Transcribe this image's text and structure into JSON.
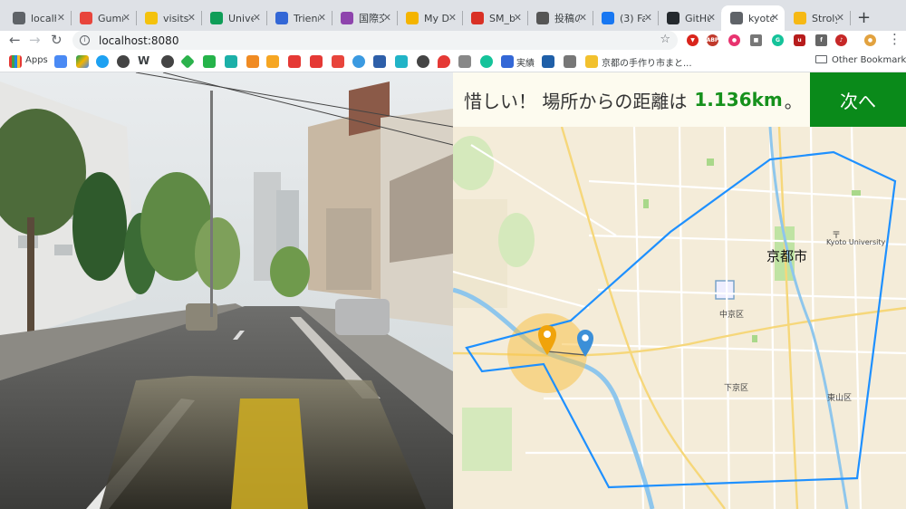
{
  "tabs": [
    {
      "title": "localh",
      "icon": "globe-icon",
      "color": "#5f6368"
    },
    {
      "title": "Gumm",
      "icon": "gumroad-icon",
      "color": "#e8453c"
    },
    {
      "title": "visits",
      "icon": "chat-icon",
      "color": "#f4c20d"
    },
    {
      "title": "Unive",
      "icon": "sheets-icon",
      "color": "#0f9d58"
    },
    {
      "title": "Trienn",
      "icon": "globe-blue-icon",
      "color": "#3367d6"
    },
    {
      "title": "国際交",
      "icon": "purple-app-icon",
      "color": "#8e44ad"
    },
    {
      "title": "My Dr",
      "icon": "drive-icon",
      "color": "#f4b400"
    },
    {
      "title": "SM_b",
      "icon": "pdf-icon",
      "color": "#d93025"
    },
    {
      "title": "投稿の",
      "icon": "wordpress-icon",
      "color": "#555555"
    },
    {
      "title": "(3) Fa",
      "icon": "facebook-icon",
      "color": "#1877f2"
    },
    {
      "title": "GitHu",
      "icon": "github-icon",
      "color": "#24292e"
    },
    {
      "title": "kyoto",
      "icon": "globe-icon",
      "color": "#5f6368",
      "active": true
    },
    {
      "title": "Stroly",
      "icon": "stroly-icon",
      "color": "#f6b915"
    }
  ],
  "address": {
    "url": "localhost:8080"
  },
  "bookmarks": {
    "apps_label": "Apps",
    "w_label": "W",
    "jisseki_label": "実績",
    "kyoto_label": "京都の手作り市まと...",
    "other_label": "Other Bookmarks"
  },
  "result": {
    "prefix": "惜しい！ 場所からの距離は",
    "distance": "1.136km",
    "suffix": "。",
    "next_label": "次へ"
  },
  "map": {
    "city": "京都市",
    "univ": "Kyoto University",
    "univ_symbol": "〒",
    "wards": [
      "中京区",
      "下京区",
      "東山区"
    ]
  },
  "colors": {
    "next_button": "#0a8a1a",
    "distance_text": "#16911c",
    "area_outline": "#1e90ff",
    "guess_pin": "#f0a30a",
    "answer_pin": "#3b8fd8"
  }
}
